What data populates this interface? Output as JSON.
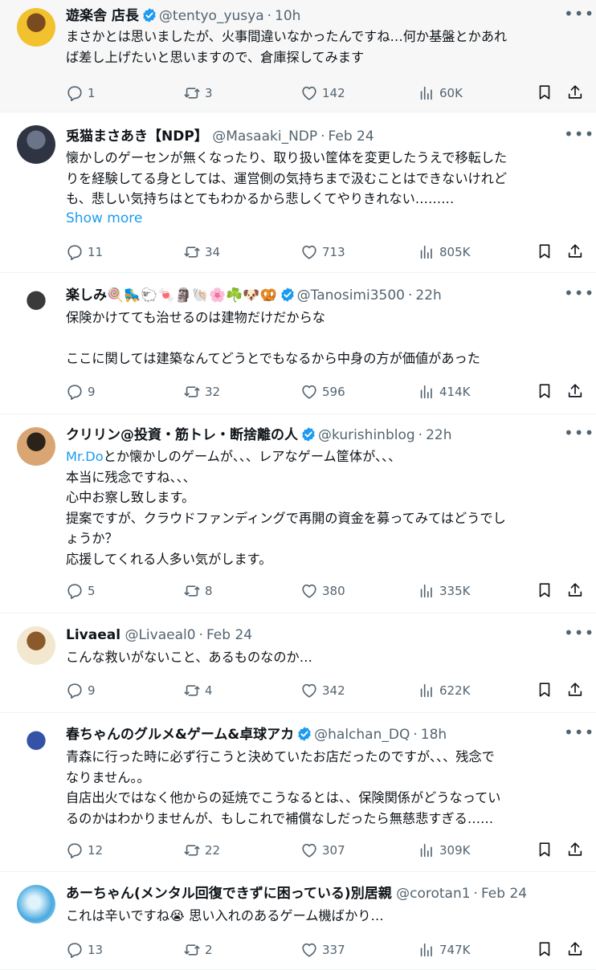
{
  "tweets": [
    {
      "name": "遊楽舎 店長",
      "verified": true,
      "handle": "@tentyo_yusya",
      "time": "10h",
      "lines": [
        "まさかとは思いましたが、火事間違いなかったんですね…何か基盤とかあれ",
        "ば差し上げたいと思いますので、倉庫探してみます"
      ],
      "replies": "1",
      "reposts": "3",
      "likes": "142",
      "views": "60K"
    },
    {
      "name": "兎猫まさあき【NDP】",
      "verified": false,
      "handle": "@Masaaki_NDP",
      "time": "Feb 24",
      "lines": [
        "懐かしのゲーセンが無くなったり、取り扱い筐体を変更したうえで移転した",
        "りを経験してる身としては、運営側の気持ちまで汲むことはできないけれど",
        "も、悲しい気持ちはとてもわかるから悲しくてやりきれない………"
      ],
      "show_more": "Show more",
      "replies": "11",
      "reposts": "34",
      "likes": "713",
      "views": "805K"
    },
    {
      "name": "楽しみ🍭🛼🐑🍬🗿🐚🌸☘️🐶🥨",
      "verified": true,
      "handle": "@Tanosimi3500",
      "time": "22h",
      "lines": [
        "保険かけてても治せるのは建物だけだからな",
        "",
        "ここに関しては建築なんてどうとでもなるから中身の方が価値があった"
      ],
      "replies": "9",
      "reposts": "32",
      "likes": "596",
      "views": "414K"
    },
    {
      "name": "クリリン@投資・筋トレ・断捨離の人",
      "verified": true,
      "handle": "@kurishinblog",
      "time": "22h",
      "mention": "Mr.Do",
      "lines": [
        "とか懐かしのゲームが、、、レアなゲーム筐体が、、、",
        "本当に残念ですね、、、",
        "心中お察し致します。",
        "提案ですが、クラウドファンディングで再開の資金を募ってみてはどうでし",
        "ょうか？",
        "応援してくれる人多い気がします。"
      ],
      "replies": "5",
      "reposts": "8",
      "likes": "380",
      "views": "335K"
    },
    {
      "name": "Livaeal",
      "verified": false,
      "handle": "@Livaeal0",
      "time": "Feb 24",
      "lines": [
        "こんな救いがないこと、あるものなのか…"
      ],
      "replies": "9",
      "reposts": "4",
      "likes": "342",
      "views": "622K"
    },
    {
      "name": "春ちゃんのグルメ&ゲーム&卓球アカ",
      "verified": true,
      "handle": "@halchan_DQ",
      "time": "18h",
      "lines": [
        "青森に行った時に必ず行こうと決めていたお店だったのですが、、、残念で",
        "なりません。。",
        "自店出火ではなく他からの延焼でこうなるとは、、保険関係がどうなってい",
        "るのかはわかりませんが、もしこれで補償なしだったら無慈悲すぎる……"
      ],
      "replies": "12",
      "reposts": "22",
      "likes": "307",
      "views": "309K"
    },
    {
      "name": "あーちゃん(メンタル回復できずに困っている)別居親",
      "verified": false,
      "handle": "@corotan1",
      "time": "Feb 24",
      "lines": [
        "これは辛いですね😭 思い入れのあるゲーム機ばかり…"
      ],
      "replies": "13",
      "reposts": "2",
      "likes": "337",
      "views": "747K"
    }
  ],
  "sep": "·",
  "more_glyph": "•••",
  "colors": {
    "accent": "#1d9bf0",
    "muted": "#536471",
    "text": "#0f1419",
    "divider": "#eff3f4",
    "highlight": "#f7f7f7"
  },
  "icons": [
    "reply-icon",
    "repost-icon",
    "like-icon",
    "views-icon",
    "bookmark-icon",
    "share-icon",
    "more-icon",
    "verified-icon"
  ]
}
